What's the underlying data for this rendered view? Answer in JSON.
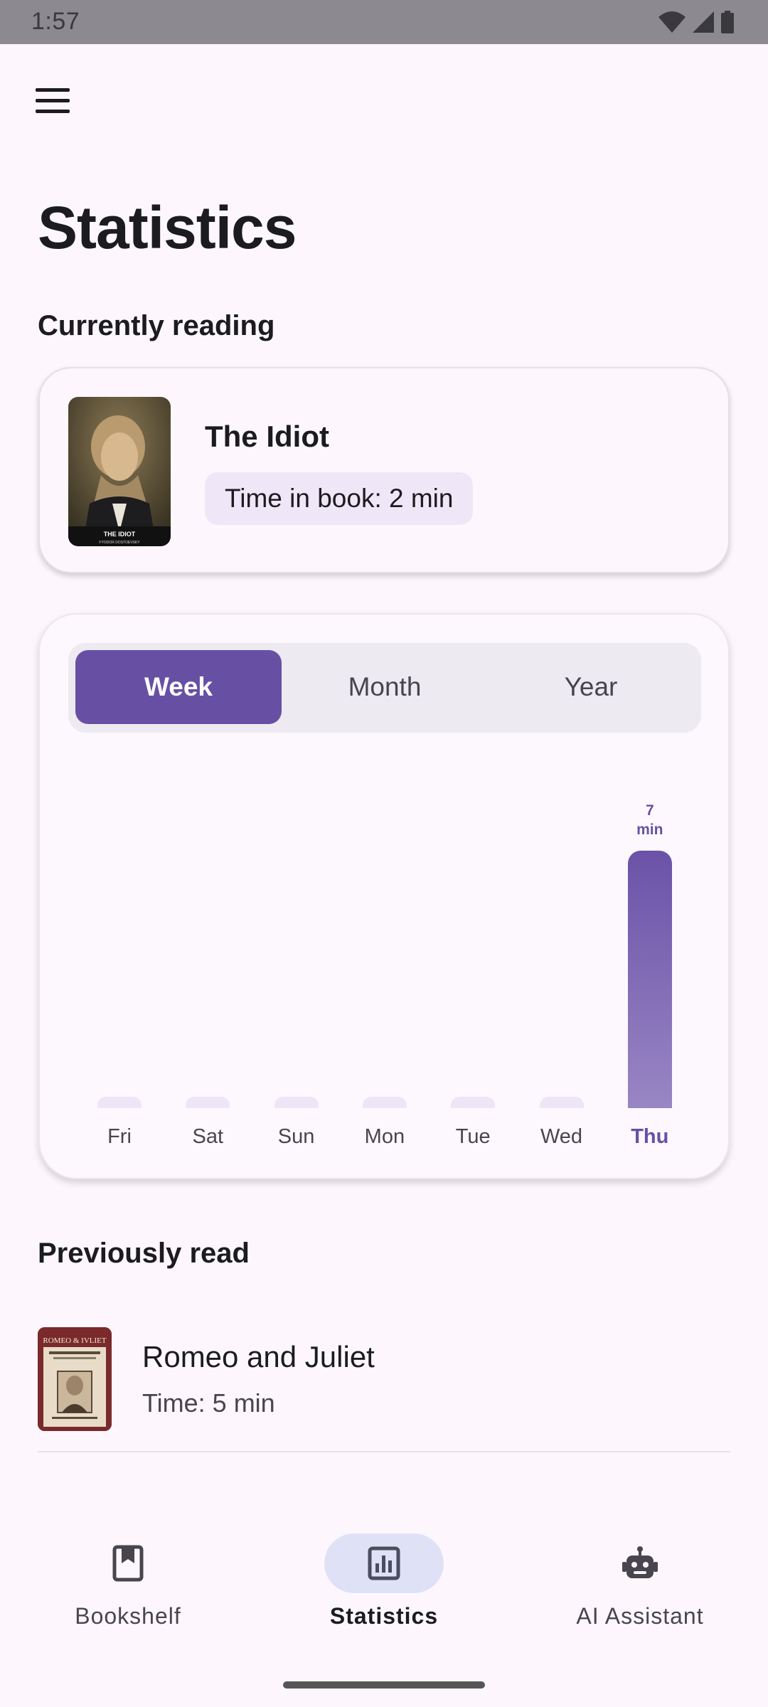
{
  "status_bar": {
    "time": "1:57"
  },
  "page": {
    "title": "Statistics"
  },
  "currently_reading": {
    "section_title": "Currently reading",
    "book": {
      "title": "The Idiot",
      "time_chip": "Time in book: 2 min",
      "cover_title": "THE IDIOT",
      "cover_author": "FYODOR DOSTOEVSKY"
    }
  },
  "period_tabs": [
    {
      "label": "Week",
      "selected": true
    },
    {
      "label": "Month",
      "selected": false
    },
    {
      "label": "Year",
      "selected": false
    }
  ],
  "chart_data": {
    "type": "bar",
    "categories": [
      "Fri",
      "Sat",
      "Sun",
      "Mon",
      "Tue",
      "Wed",
      "Thu"
    ],
    "values": [
      0,
      0,
      0,
      0,
      0,
      0,
      7
    ],
    "unit": "min",
    "highlighted": "Thu",
    "data_labels": {
      "Thu": [
        "7",
        "min"
      ]
    }
  },
  "previously_read": {
    "section_title": "Previously read",
    "items": [
      {
        "title": "Romeo and Juliet",
        "time": "Time: 5 min",
        "cover_title": "ROMEO & IVLIET"
      }
    ]
  },
  "bottom_nav": {
    "items": [
      {
        "label": "Bookshelf",
        "icon": "bookmark-book-icon",
        "active": false
      },
      {
        "label": "Statistics",
        "icon": "bar-chart-icon",
        "active": true
      },
      {
        "label": "AI Assistant",
        "icon": "robot-icon",
        "active": false
      }
    ]
  },
  "colors": {
    "accent": "#6750a4",
    "background": "#fdf7fd",
    "nav_active_pill": "#dfe2f6"
  }
}
